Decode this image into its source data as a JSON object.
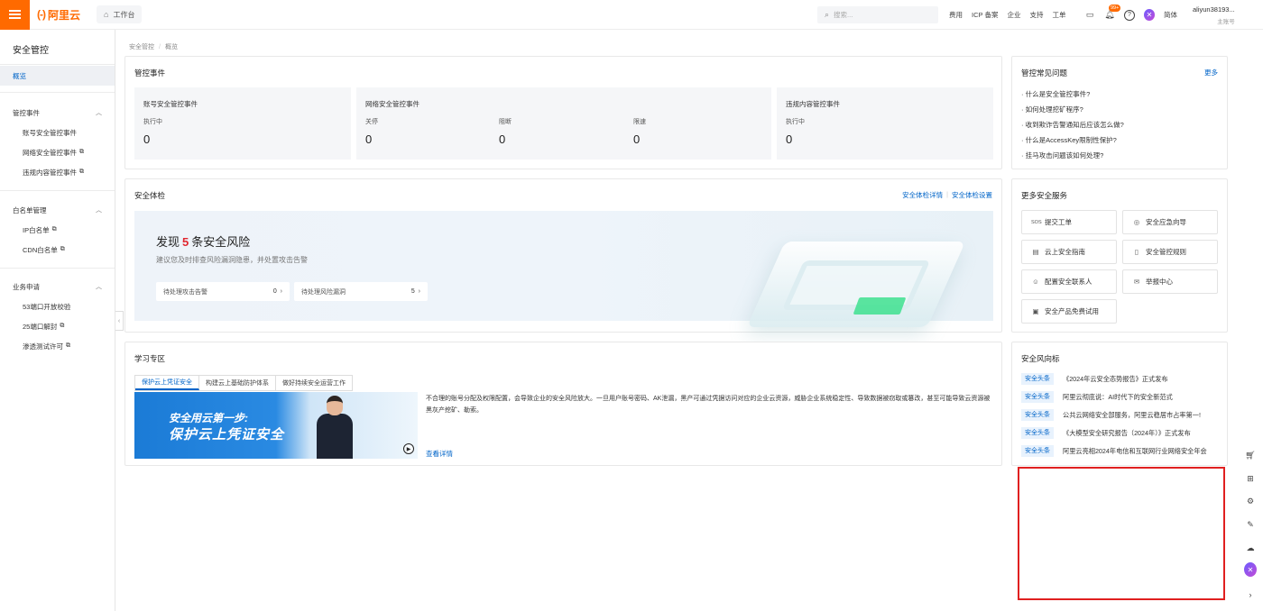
{
  "topbar": {
    "brand": "阿里云",
    "brand_mark": "(-)",
    "workbench": "工作台",
    "search_placeholder": "搜索...",
    "links": [
      "费用",
      "ICP 备案",
      "企业",
      "支持",
      "工单"
    ],
    "notification_badge": "99+",
    "language": "简体",
    "username": "aliyun38193...",
    "user_role": "主账号",
    "colors": {
      "brand": "#ff6a00",
      "link": "#0064c8"
    }
  },
  "sidebar": {
    "title": "安全管控",
    "overview": "概览",
    "groups": [
      {
        "label": "管控事件",
        "items": [
          "账号安全管控事件",
          "网络安全管控事件",
          "违规内容管控事件"
        ]
      },
      {
        "label": "白名单管理",
        "items": [
          "IP白名单",
          "CDN白名单"
        ]
      },
      {
        "label": "业务申请",
        "items": [
          "53端口开放校验",
          "25端口解封",
          "渗透测试许可"
        ]
      }
    ]
  },
  "breadcrumb": [
    "安全管控",
    "概览"
  ],
  "events": {
    "title": "管控事件",
    "account": {
      "title": "账号安全管控事件",
      "label": "执行中",
      "value": "0"
    },
    "network": {
      "title": "网络安全管控事件",
      "items": [
        {
          "label": "关停",
          "value": "0"
        },
        {
          "label": "阻断",
          "value": "0"
        },
        {
          "label": "限速",
          "value": "0"
        }
      ]
    },
    "content": {
      "title": "违规内容管控事件",
      "label": "执行中",
      "value": "0"
    }
  },
  "check": {
    "title": "安全体检",
    "detail_link": "安全体检详情",
    "settings_link": "安全体检设置",
    "headline_pre": "发现",
    "headline_num": "5",
    "headline_post": "条安全风险",
    "subtitle": "建议您及时排查风险漏洞隐患，并处置攻击告警",
    "pending_attack": {
      "label": "待处理攻击告警",
      "value": "0"
    },
    "pending_vuln": {
      "label": "待处理风险漏洞",
      "value": "5"
    }
  },
  "learning": {
    "title": "学习专区",
    "tabs": [
      "保护云上凭证安全",
      "构建云上基础防护体系",
      "做好持续安全运营工作"
    ],
    "video_line1": "安全用云第一步:",
    "video_line2": "保护云上凭证安全",
    "text": "不合理的账号分配及权限配置，会导致企业的安全风险放大。一旦用户账号密码、AK泄漏，黑产可通过凭据访问对应的企业云资源，威胁企业系统稳定性、导致数据被窃取或篡改，甚至可能导致云资源被黑灰产挖矿、勒索。",
    "more": "查看详情"
  },
  "faq": {
    "title": "管控常见问题",
    "more": "更多",
    "items": [
      "· 什么是安全管控事件?",
      "· 如何处理挖矿程序?",
      "· 收到欺诈告警通知后应该怎么做?",
      "· 什么是AccessKey限制性保护?",
      "· 挂马攻击问题该如何处理?"
    ]
  },
  "services": {
    "title": "更多安全服务",
    "items": [
      {
        "icon": "sos",
        "label": "提交工单"
      },
      {
        "icon": "compass",
        "label": "安全应急向导"
      },
      {
        "icon": "book",
        "label": "云上安全指南"
      },
      {
        "icon": "doc",
        "label": "安全管控规则"
      },
      {
        "icon": "person",
        "label": "配置安全联系人"
      },
      {
        "icon": "mail",
        "label": "举报中心"
      },
      {
        "icon": "box",
        "label": "安全产品免费试用"
      }
    ]
  },
  "news": {
    "title": "安全风向标",
    "tag": "安全头条",
    "items": [
      "《2024年云安全态势报告》正式发布",
      "阿里云彻底说：AI时代下的安全新范式",
      "公共云网络安全部服务，阿里云稳居市占率第一!",
      "《大模型安全研究报告（2024年）》正式发布",
      "阿里云亮相2024年电信和互联网行业网络安全年会"
    ]
  }
}
